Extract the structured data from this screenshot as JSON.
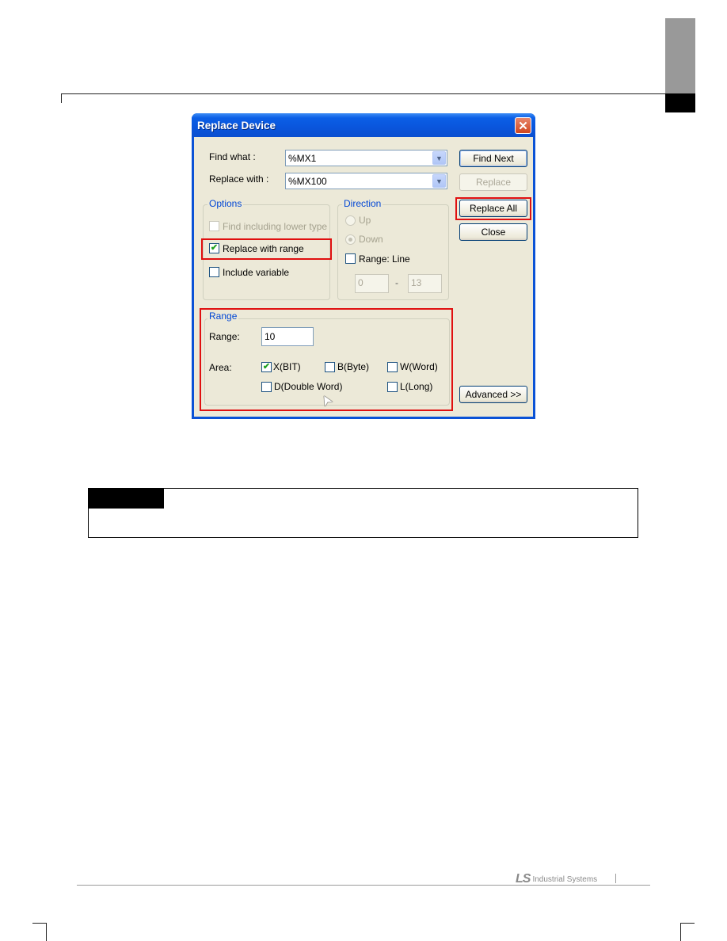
{
  "page": {
    "footer_brand_mark": "LS",
    "footer_brand_text": "Industrial Systems"
  },
  "dialog": {
    "title": "Replace Device",
    "close_glyph": "✕",
    "find_what": {
      "label": "Find what :",
      "value": "%MX1",
      "arrow": "▼"
    },
    "replace_with": {
      "label": "Replace with :",
      "value": "%MX100",
      "arrow": "▼"
    },
    "buttons": {
      "find_next": "Find Next",
      "replace": "Replace",
      "replace_all": "Replace All",
      "close": "Close",
      "advanced": "Advanced >>"
    },
    "options": {
      "title": "Options",
      "find_including_lower_type": {
        "label": "Find including lower type",
        "checked": false,
        "enabled": false
      },
      "replace_with_range": {
        "label": "Replace with range",
        "checked": true
      },
      "include_variable": {
        "label": "Include variable",
        "checked": false
      }
    },
    "direction": {
      "title": "Direction",
      "up": {
        "label": "Up",
        "selected": false,
        "enabled": false
      },
      "down": {
        "label": "Down",
        "selected": true,
        "enabled": false
      },
      "range_line": {
        "label": "Range: Line",
        "checked": false
      },
      "line_from": "0",
      "line_separator": "-",
      "line_to": "13"
    },
    "range": {
      "title": "Range",
      "range_label": "Range:",
      "range_value": "10",
      "area_label": "Area:",
      "areas": [
        {
          "label": "X(BIT)",
          "checked": true
        },
        {
          "label": "B(Byte)",
          "checked": false
        },
        {
          "label": "W(Word)",
          "checked": false
        },
        {
          "label": "D(Double Word)",
          "checked": false
        },
        {
          "label": "L(Long)",
          "checked": false
        }
      ]
    },
    "check_glyph": "✔",
    "cursor_glyph": "➤"
  },
  "colors": {
    "highlight": "#e01010",
    "title_bar": "#0a55dc",
    "dialog_face": "#ece9d8",
    "group_title": "#0046d5"
  }
}
